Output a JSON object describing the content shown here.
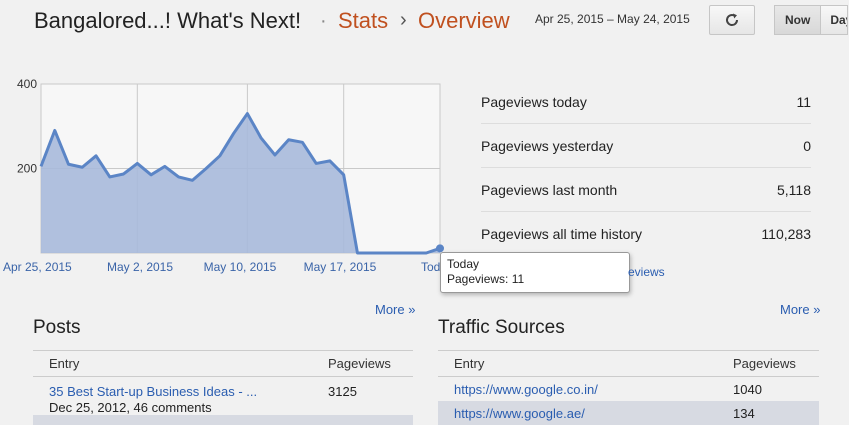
{
  "header": {
    "blog_title": "Bangalored...! What's Next!",
    "separator": "·",
    "crumb_stats": "Stats",
    "crumb_chevron": "›",
    "crumb_overview": "Overview",
    "date_range": "Apr 25, 2015 – May 24, 2015",
    "refresh_icon": "refresh-icon",
    "period_now": "Now",
    "period_day": "Day"
  },
  "chart_data": {
    "type": "area",
    "title": "",
    "xlabel": "",
    "ylabel": "",
    "ylim": [
      0,
      400
    ],
    "y_ticks": [
      "400",
      "200"
    ],
    "x_tick_labels": [
      "Apr 25, 2015",
      "May 2, 2015",
      "May 10, 2015",
      "May 17, 2015",
      "Today"
    ],
    "x": [
      "Apr 25",
      "Apr 26",
      "Apr 27",
      "Apr 28",
      "Apr 29",
      "Apr 30",
      "May 1",
      "May 2",
      "May 3",
      "May 4",
      "May 5",
      "May 6",
      "May 7",
      "May 8",
      "May 9",
      "May 10",
      "May 11",
      "May 12",
      "May 13",
      "May 14",
      "May 15",
      "May 16",
      "May 17",
      "May 18",
      "May 19",
      "May 20",
      "May 21",
      "May 22",
      "May 23",
      "May 24"
    ],
    "series": [
      {
        "values": [
          205,
          290,
          210,
          203,
          230,
          180,
          187,
          212,
          185,
          205,
          180,
          172,
          200,
          230,
          283,
          330,
          272,
          232,
          268,
          262,
          212,
          218,
          185,
          0,
          0,
          0,
          0,
          0,
          0,
          11
        ]
      }
    ],
    "grid": true,
    "area_color": "#a7b9da",
    "line_color": "#5b85c6"
  },
  "tooltip": {
    "line1": "Today",
    "line2": "Pageviews: 11"
  },
  "stats": [
    {
      "label": "Pageviews today",
      "value": "11"
    },
    {
      "label": "Pageviews yesterday",
      "value": "0"
    },
    {
      "label": "Pageviews last month",
      "value": "5,118"
    },
    {
      "label": "Pageviews all time history",
      "value": "110,283"
    }
  ],
  "stats_link_partial": "eviews",
  "posts": {
    "more": "More »",
    "title": "Posts",
    "col_entry": "Entry",
    "col_pageviews": "Pageviews",
    "rows": [
      {
        "title": "35 Best Start-up Business Ideas - ...",
        "meta": "Dec 25, 2012, 46 comments",
        "views": "3125"
      },
      {
        "title": "",
        "meta": "",
        "views": ""
      }
    ]
  },
  "traffic": {
    "more": "More »",
    "title": "Traffic Sources",
    "col_entry": "Entry",
    "col_pageviews": "Pageviews",
    "rows": [
      {
        "entry": "https://www.google.co.in/",
        "views": "1040"
      },
      {
        "entry": "https://www.google.ae/",
        "views": "134"
      }
    ]
  },
  "colors": {
    "accent": "#c0501f",
    "link": "#2a5db0",
    "alt_row": "#d7dae2"
  }
}
